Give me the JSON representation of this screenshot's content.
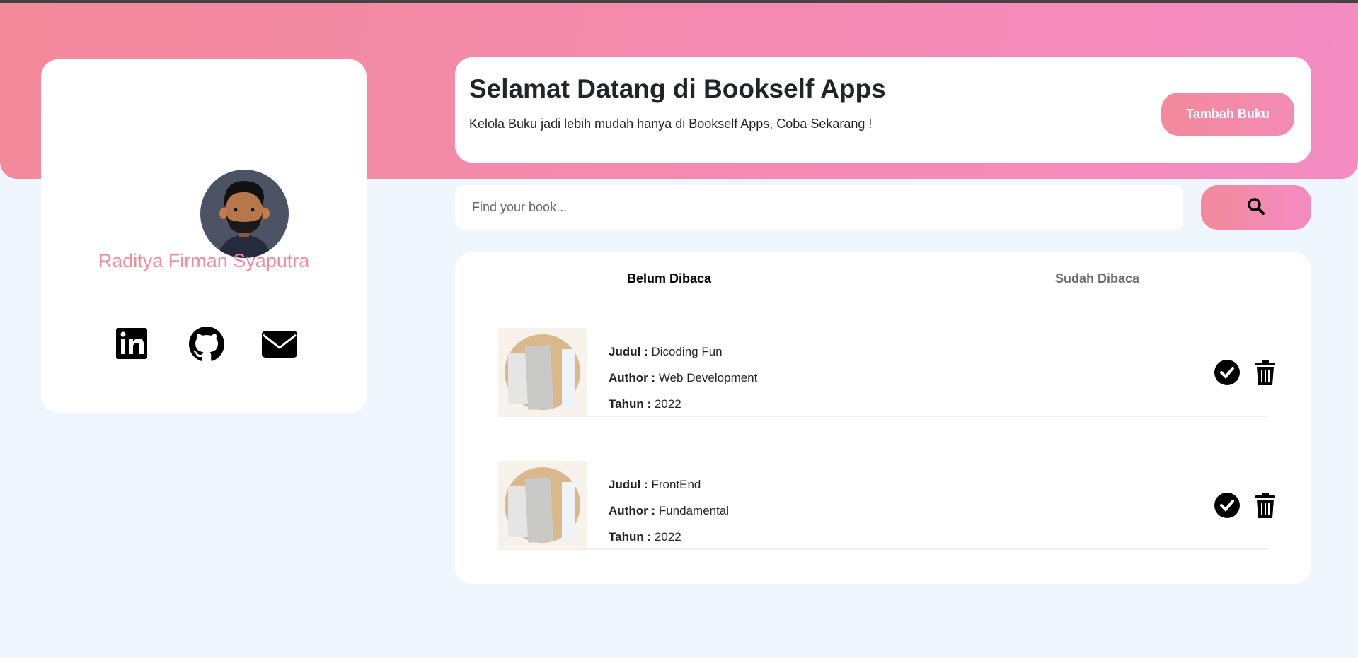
{
  "profile": {
    "name": "Raditya Firman Syaputra",
    "links": [
      {
        "icon": "linkedin-icon"
      },
      {
        "icon": "github-icon"
      },
      {
        "icon": "email-icon"
      }
    ]
  },
  "welcome": {
    "title": "Selamat Datang di Bookself Apps",
    "subtitle": "Kelola Buku jadi lebih mudah hanya di Bookself Apps, Coba Sekarang !",
    "add_button": "Tambah Buku"
  },
  "search": {
    "placeholder": "Find your book...",
    "value": ""
  },
  "tabs": [
    {
      "label": "Belum Dibaca",
      "active": true
    },
    {
      "label": "Sudah Dibaca",
      "active": false
    }
  ],
  "labels": {
    "title": "Judul :",
    "author": "Author :",
    "year": "Tahun :"
  },
  "books": [
    {
      "title": "Dicoding Fun",
      "author": "Web Development",
      "year": "2022"
    },
    {
      "title": "FrontEnd",
      "author": "Fundamental",
      "year": "2022"
    }
  ],
  "colors": {
    "accent": "#f28a9b",
    "gradient_end": "#f48bc2",
    "background": "#eff6fe"
  }
}
